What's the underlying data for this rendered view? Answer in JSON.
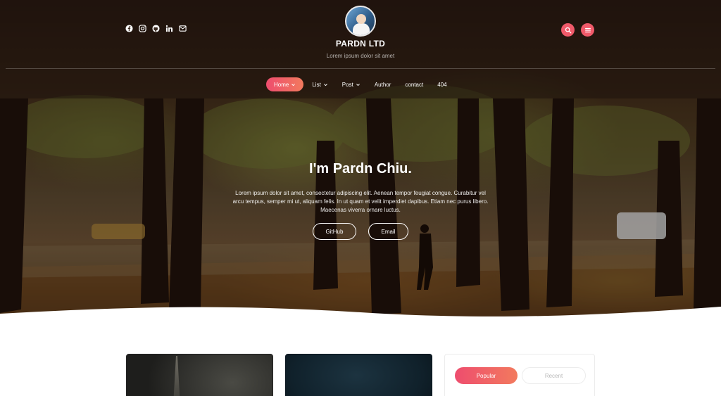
{
  "header": {
    "social_icons": [
      "facebook-icon",
      "instagram-icon",
      "github-icon",
      "linkedin-icon",
      "mail-icon"
    ],
    "title": "PARDN LTD",
    "tagline": "Lorem ipsum dolor sit amet",
    "search_icon": "search-icon",
    "menu_icon": "menu-icon"
  },
  "nav": {
    "items": [
      {
        "label": "Home",
        "dropdown": true,
        "active": true
      },
      {
        "label": "List",
        "dropdown": true
      },
      {
        "label": "Post",
        "dropdown": true
      },
      {
        "label": "Author",
        "dropdown": false
      },
      {
        "label": "contact",
        "dropdown": false
      },
      {
        "label": "404",
        "dropdown": false
      }
    ]
  },
  "hero": {
    "title": "I'm Pardn Chiu.",
    "description": "Lorem ipsum dolor sit amet, consectetur adipiscing elit. Aenean tempor feugiat congue. Curabitur vel arcu tempus, semper mi ut, aliquam felis. In ut quam et velit imperdiet dapibus. Etiam nec purus libero. Maecenas viverra ornare luctus.",
    "buttons": {
      "github": "GitHub",
      "email": "Email"
    }
  },
  "sidebar": {
    "tabs": {
      "popular": "Popular",
      "recent": "Recent"
    }
  },
  "colors": {
    "accent": "#f05a6a",
    "gradient_start": "#ee4d6e",
    "gradient_end": "#f27a5e"
  }
}
